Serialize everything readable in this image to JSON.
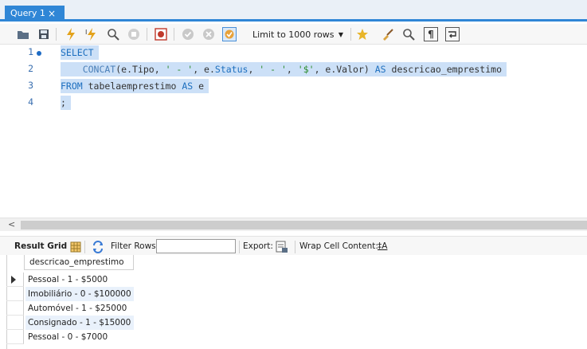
{
  "tab": {
    "title": "Query 1",
    "close": "×"
  },
  "toolbar": {
    "icons": [
      "folder-icon",
      "save-icon",
      "execute-icon",
      "execute-current-icon",
      "explain-icon",
      "stop-icon",
      "toggle-error-icon",
      "commit-icon",
      "rollback-icon",
      "autocommit-icon",
      "bookmark-icon",
      "beautify-icon",
      "find-icon",
      "invisible-chars-icon",
      "wrap-icon"
    ],
    "limit_select": "Limit to 1000 rows"
  },
  "editor": {
    "line_numbers": [
      "1",
      "2",
      "3",
      "4"
    ],
    "lines": [
      [
        {
          "t": "SELECT",
          "c": "kw"
        }
      ],
      [
        {
          "t": "    CONCAT",
          "c": "fn"
        },
        {
          "t": "(e.Tipo, ",
          "c": "plain"
        },
        {
          "t": "' - '",
          "c": "str"
        },
        {
          "t": ", e.",
          "c": "plain"
        },
        {
          "t": "Status",
          "c": "kw"
        },
        {
          "t": ", ",
          "c": "plain"
        },
        {
          "t": "' - '",
          "c": "str"
        },
        {
          "t": ", ",
          "c": "plain"
        },
        {
          "t": "'$'",
          "c": "str"
        },
        {
          "t": ", e.Valor) ",
          "c": "plain"
        },
        {
          "t": "AS",
          "c": "kw"
        },
        {
          "t": " descricao_emprestimo",
          "c": "plain"
        }
      ],
      [
        {
          "t": "FROM",
          "c": "kw"
        },
        {
          "t": " tabelaemprestimo ",
          "c": "plain"
        },
        {
          "t": "AS",
          "c": "kw"
        },
        {
          "t": " e",
          "c": "plain"
        }
      ],
      [
        {
          "t": ";",
          "c": "plain"
        }
      ]
    ]
  },
  "scrollbar": {
    "left_arrow": "<"
  },
  "result_toolbar": {
    "result_grid": "Result Grid",
    "filter_rows": "Filter Rows:",
    "filter_value": "",
    "export": "Export:",
    "wrap_cell": "Wrap Cell Content:",
    "wrap_icon_text": "‡A"
  },
  "grid": {
    "column": "descricao_emprestimo",
    "rows": [
      "Pessoal - 1 - $5000",
      "Imobiliário - 0 - $100000",
      "Automóvel - 1 - $25000",
      "Consignado - 1 - $15000",
      "Pessoal - 0 - $7000"
    ]
  }
}
